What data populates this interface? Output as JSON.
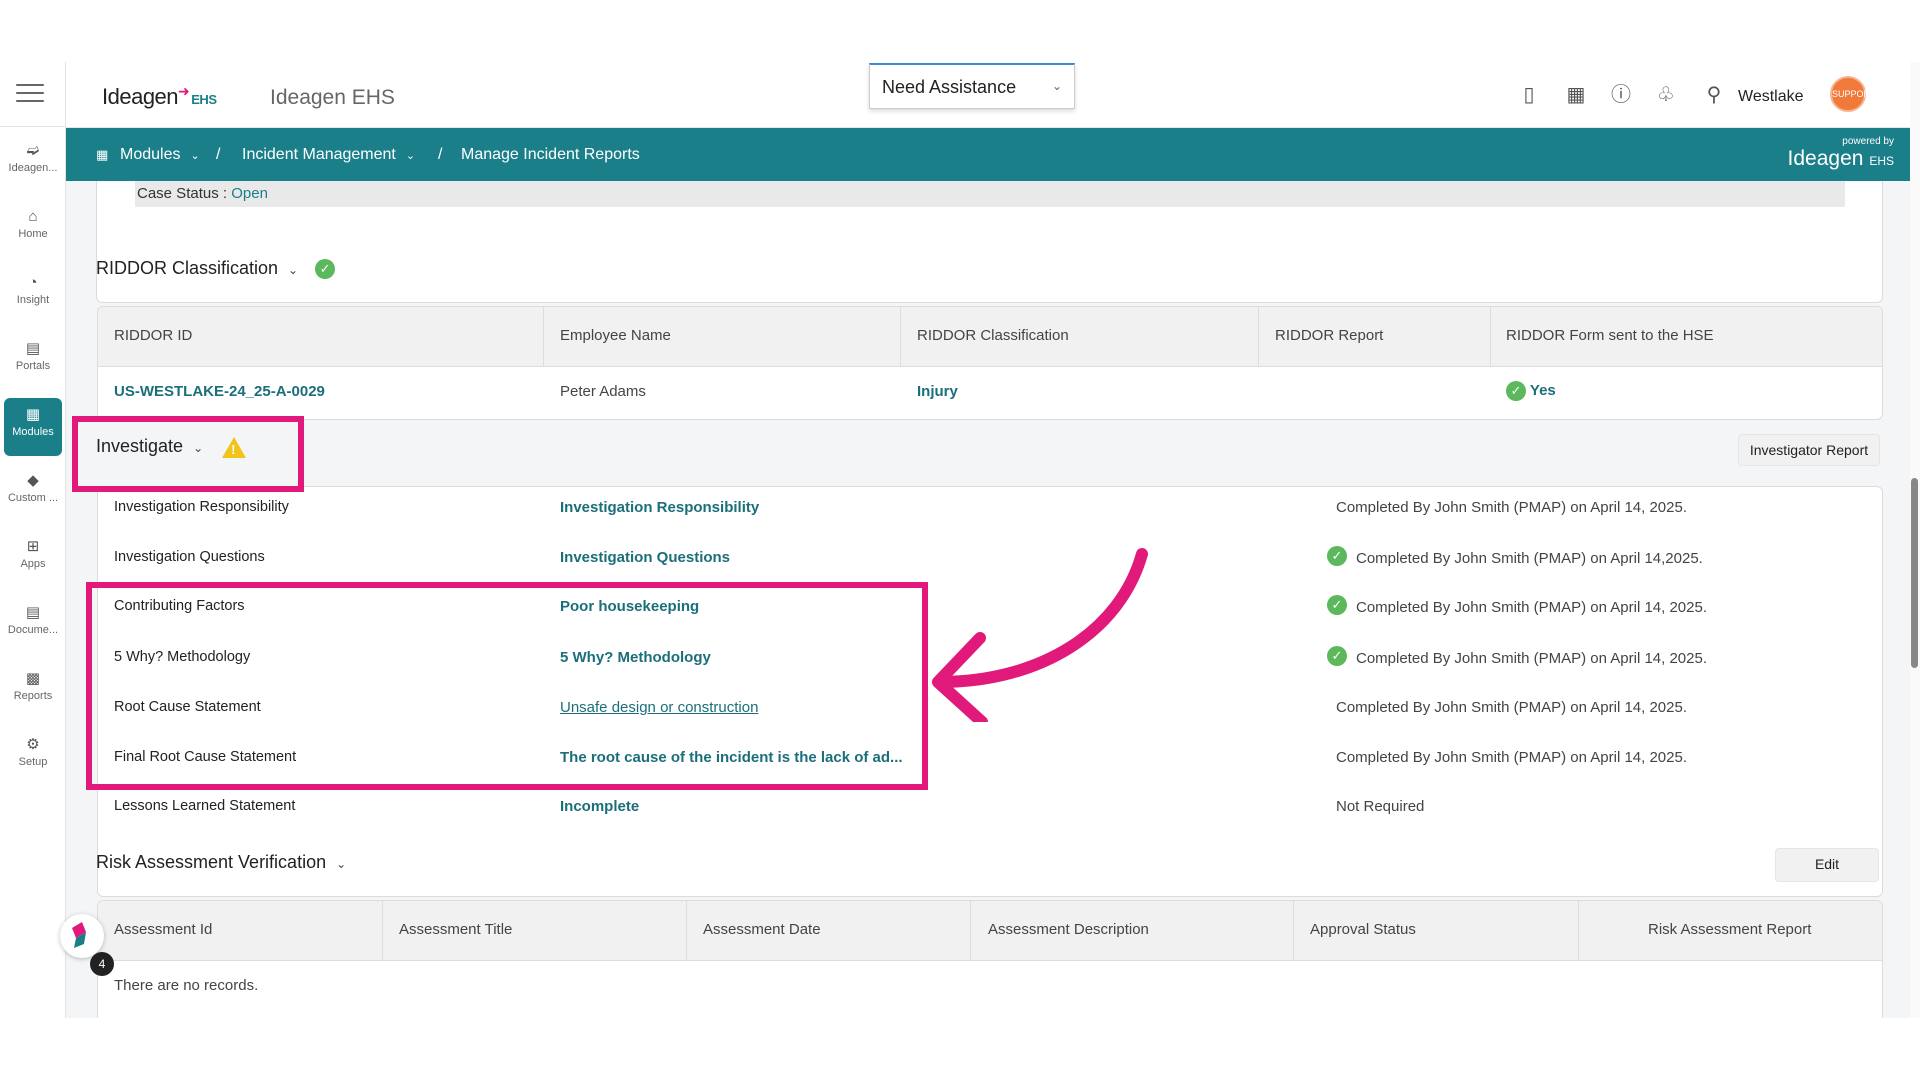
{
  "sidebar": {
    "items": [
      {
        "label": "Ideagen..."
      },
      {
        "label": "Home"
      },
      {
        "label": "Insight"
      },
      {
        "label": "Portals"
      },
      {
        "label": "Modules"
      },
      {
        "label": "Custom ..."
      },
      {
        "label": "Apps"
      },
      {
        "label": "Docume..."
      },
      {
        "label": "Reports"
      },
      {
        "label": "Setup"
      }
    ],
    "active_index": 4
  },
  "header": {
    "logo_text": "Ideagen",
    "logo_suffix": "EHS",
    "app_name": "Ideagen EHS",
    "assistance_select": "Need Assistance",
    "user_name": "Westlake",
    "avatar_text": "SUPPORT"
  },
  "breadcrumb": {
    "items": [
      "Modules",
      "Incident Management",
      "Manage Incident Reports"
    ],
    "separator": "/",
    "powered_by": "powered by",
    "powered_logo": "Ideagen",
    "powered_suffix": "EHS"
  },
  "case_status": {
    "label": "Case Status :",
    "value": "Open"
  },
  "riddor": {
    "title": "RIDDOR Classification",
    "columns": [
      "RIDDOR ID",
      "Employee Name",
      "RIDDOR Classification",
      "RIDDOR Report",
      "RIDDOR Form sent to the HSE"
    ],
    "row": {
      "id": "US-WESTLAKE-24_25-A-0029",
      "employee": "Peter Adams",
      "classification": "Injury",
      "report": "",
      "form_sent": "Yes"
    }
  },
  "investigate": {
    "title": "Investigate",
    "report_button": "Investigator Report",
    "rows": [
      {
        "name": "Investigation Responsibility",
        "value": "Investigation Responsibility",
        "status": "Completed By John Smith (PMAP) on April 14, 2025.",
        "check": false
      },
      {
        "name": "Investigation Questions",
        "value": "Investigation Questions",
        "status": "Completed By John Smith (PMAP) on April 14,2025.",
        "check": true
      },
      {
        "name": "Contributing Factors",
        "value": "Poor housekeeping",
        "status": "Completed By John Smith (PMAP) on April 14, 2025.",
        "check": true
      },
      {
        "name": "5 Why? Methodology",
        "value": "5 Why? Methodology",
        "status": "Completed By John Smith (PMAP) on April 14, 2025.",
        "check": true
      },
      {
        "name": "Root Cause Statement",
        "value": "Unsafe design or construction",
        "status": "Completed By John Smith (PMAP) on April 14, 2025.",
        "check": false
      },
      {
        "name": "Final Root Cause Statement",
        "value": "The root cause of the incident is the lack of ad...",
        "status": "Completed By John Smith (PMAP) on April 14, 2025.",
        "check": false
      },
      {
        "name": "Lessons Learned Statement",
        "value": "Incomplete",
        "status": "Not Required",
        "check": false
      }
    ]
  },
  "risk": {
    "title": "Risk Assessment Verification",
    "edit_button": "Edit",
    "columns": [
      "Assessment Id",
      "Assessment Title",
      "Assessment Date",
      "Assessment Description",
      "Approval Status",
      "Risk Assessment Report"
    ],
    "empty_text": "There are no records."
  },
  "chat_badge": "4",
  "colors": {
    "teal": "#1b7f8a",
    "highlight": "#e0197a",
    "success": "#5cb85c",
    "warning": "#f0c419"
  }
}
